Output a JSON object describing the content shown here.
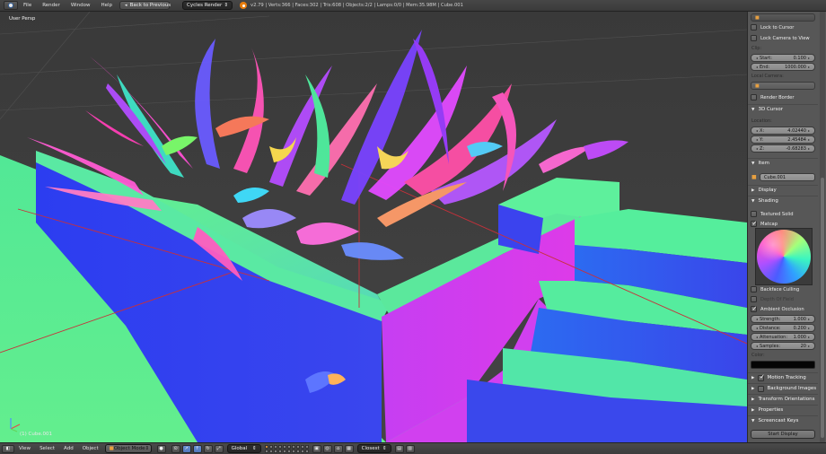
{
  "top_bar": {
    "menus": [
      "File",
      "Render",
      "Window",
      "Help"
    ],
    "back_button": "Back to Previous",
    "render_engine": "Cycles Render",
    "stats": "v2.79 | Verts:366 | Faces:302 | Tris:608 | Objects:2/2 | Lamps:0/0 | Mem:35.98M | Cube.001"
  },
  "viewport": {
    "view_label": "User Persp",
    "object_label": "(1) Cube.001"
  },
  "panel": {
    "lock_to_cursor": "Lock to Cursor",
    "lock_camera": "Lock Camera to View",
    "clip_label": "Clip:",
    "clip_start_label": "Start:",
    "clip_start_value": "0.100",
    "clip_end_label": "End:",
    "clip_end_value": "1000.000",
    "local_camera_label": "Local Camera:",
    "render_border": "Render Border",
    "cursor_header": "3D Cursor",
    "location_label": "Location:",
    "cursor_x_label": "X:",
    "cursor_x": "4.02440",
    "cursor_y_label": "Y:",
    "cursor_y": "2.45484",
    "cursor_z_label": "Z:",
    "cursor_z": "-0.68283",
    "item_header": "Item",
    "item_name": "Cube.001",
    "display_header": "Display",
    "shading_header": "Shading",
    "textured_solid": "Textured Solid",
    "matcap": "Matcap",
    "backface_culling": "Backface Culling",
    "depth_of_field": "Depth Of Field",
    "ambient_occlusion": "Ambient Occlusion",
    "ao_strength_label": "Strength:",
    "ao_strength": "1.000",
    "ao_distance_label": "Distance:",
    "ao_distance": "0.200",
    "ao_attenuation_label": "Attenuation:",
    "ao_attenuation": "1.000",
    "ao_samples_label": "Samples:",
    "ao_samples": "20",
    "color_label": "Color:",
    "motion_tracking": "Motion Tracking",
    "background_images": "Background Images",
    "transform_orientations": "Transform Orientations",
    "properties": "Properties",
    "screencast_keys": "Screencast Keys",
    "start_display": "Start Display"
  },
  "bottom_bar": {
    "menus": [
      "View",
      "Select",
      "Add",
      "Object"
    ],
    "mode": "Object Mode",
    "orientation": "Global",
    "snap_target": "Closest"
  },
  "colors": {
    "grass": "#56e98f",
    "wall_blue": "#3140ef",
    "wall_pink": "#d33ef0",
    "wall_top": "#56ec9a",
    "panel_bg": "#575757"
  }
}
